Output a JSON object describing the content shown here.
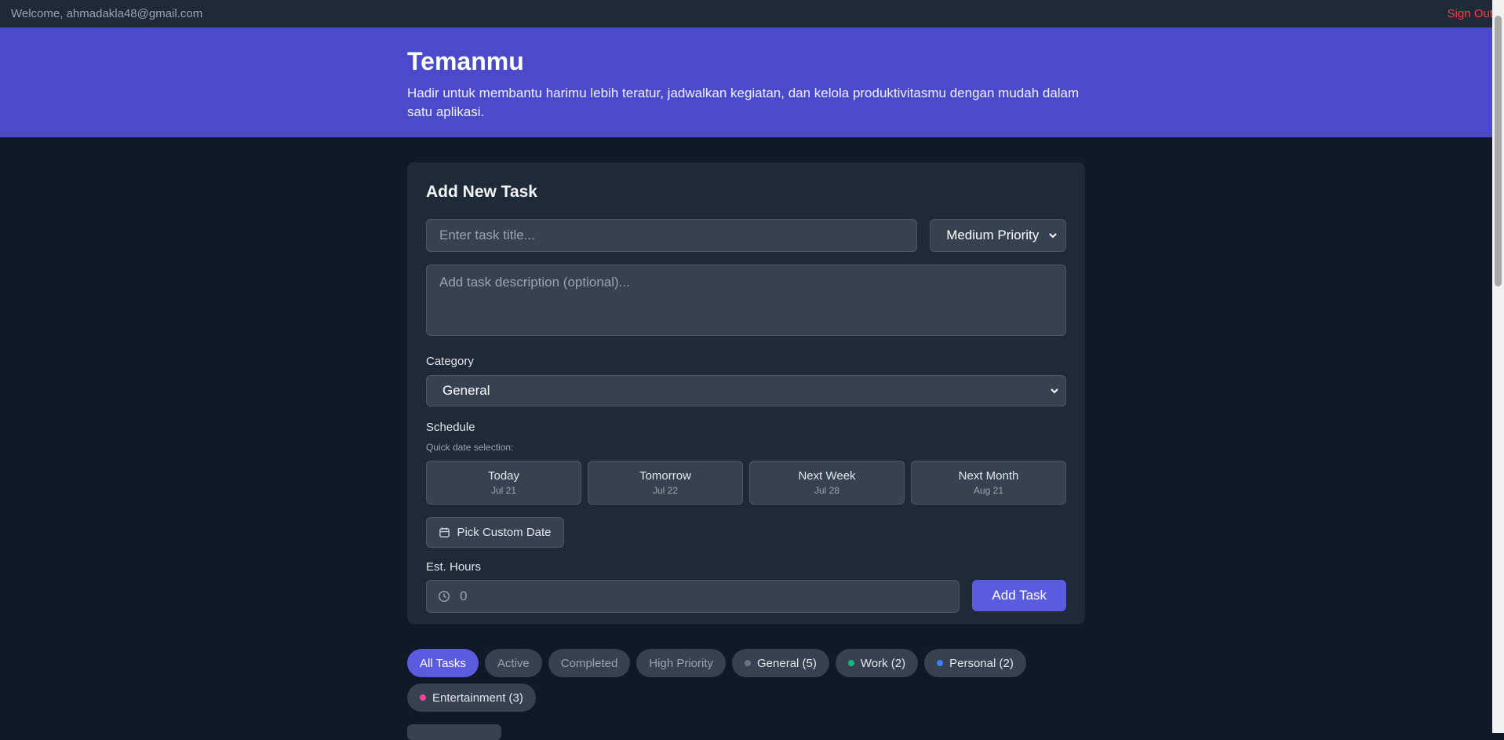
{
  "topbar": {
    "welcome": "Welcome, ahmadakla48@gmail.com",
    "sign_out": "Sign Out"
  },
  "hero": {
    "title": "Temanmu",
    "subtitle": "Hadir untuk membantu harimu lebih teratur, jadwalkan kegiatan, dan kelola produktivitasmu dengan mudah dalam satu aplikasi."
  },
  "form": {
    "heading": "Add New Task",
    "title_placeholder": "Enter task title...",
    "priority_value": "Medium Priority",
    "description_placeholder": "Add task description (optional)...",
    "category_label": "Category",
    "category_value": "General",
    "schedule_label": "Schedule",
    "quick_date_label": "Quick date selection:",
    "quick_dates": [
      {
        "label": "Today",
        "date": "Jul 21"
      },
      {
        "label": "Tomorrow",
        "date": "Jul 22"
      },
      {
        "label": "Next Week",
        "date": "Jul 28"
      },
      {
        "label": "Next Month",
        "date": "Aug 21"
      }
    ],
    "custom_date_label": "Pick Custom Date",
    "hours_label": "Est. Hours",
    "hours_placeholder": "0",
    "add_button": "Add Task"
  },
  "filters": {
    "all": "All Tasks",
    "active": "Active",
    "completed": "Completed",
    "high_priority": "High Priority",
    "categories": [
      {
        "label": "General (5)",
        "color": "#6b7280"
      },
      {
        "label": "Work (2)",
        "color": "#10b981"
      },
      {
        "label": "Personal (2)",
        "color": "#3b82f6"
      },
      {
        "label": "Entertainment (3)",
        "color": "#ec4899"
      }
    ]
  },
  "colors": {
    "accent": "#5b5be0",
    "hero": "#4a4acb",
    "sign_out": "#ef4444"
  }
}
